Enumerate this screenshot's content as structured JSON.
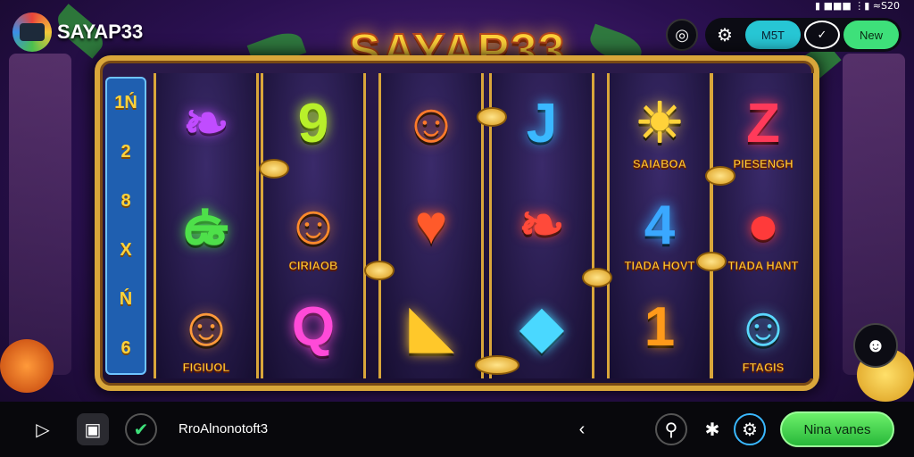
{
  "header": {
    "logo_text": "SAYAP33",
    "title": "SAYAP33",
    "status": "▮ ■■■ ⋮▮ ≈S20"
  },
  "top_controls": {
    "option_1": "M5T",
    "option_3": "New"
  },
  "paylines": [
    "1Ń",
    "2",
    "8",
    "X",
    "Ń",
    "6"
  ],
  "reels": [
    [
      {
        "glyph": "❧",
        "color": "#c04cff",
        "caption": ""
      },
      {
        "glyph": "ఉ",
        "color": "#4ee04a",
        "caption": ""
      },
      {
        "glyph": "☺",
        "color": "#ff9a3a",
        "caption": "FIGIUOL"
      }
    ],
    [
      {
        "glyph": "9",
        "color": "#b8f02a",
        "caption": ""
      },
      {
        "glyph": "☺",
        "color": "#ff8a2a",
        "caption": "CIRIAOB"
      },
      {
        "glyph": "Q",
        "color": "#ff4ad8",
        "caption": ""
      }
    ],
    [
      {
        "glyph": "☺",
        "color": "#ff7a2a",
        "caption": ""
      },
      {
        "glyph": "♥",
        "color": "#ff5a2a",
        "caption": ""
      },
      {
        "glyph": "◣",
        "color": "#ffc82a",
        "caption": ""
      }
    ],
    [
      {
        "glyph": "J",
        "color": "#3ab8ff",
        "caption": ""
      },
      {
        "glyph": "❧",
        "color": "#ff4a3a",
        "caption": ""
      },
      {
        "glyph": "◆",
        "color": "#4ad8ff",
        "caption": ""
      }
    ],
    [
      {
        "glyph": "☀",
        "color": "#ffd23a",
        "caption": "SAIABOA"
      },
      {
        "glyph": "4",
        "color": "#3aa8ff",
        "caption": "TIADA HOVT"
      },
      {
        "glyph": "1",
        "color": "#ff9a1a",
        "caption": ""
      }
    ],
    [
      {
        "glyph": "Z",
        "color": "#ff3a5a",
        "caption": "PIESENGH"
      },
      {
        "glyph": "●",
        "color": "#ff3a3a",
        "caption": "TIADA HANT"
      },
      {
        "glyph": "☺",
        "color": "#5ad8ff",
        "caption": "FTAGIS"
      }
    ]
  ],
  "bottom_bar": {
    "label": "RroAlnonotoft3",
    "win_button": "Nina vanes"
  },
  "icons": {
    "settings": "gear-icon",
    "target": "target-icon",
    "user": "user-icon",
    "play": "play-icon",
    "camera": "camera-icon",
    "check": "check-icon",
    "back": "back-icon",
    "search": "search-icon",
    "share": "share-icon"
  }
}
